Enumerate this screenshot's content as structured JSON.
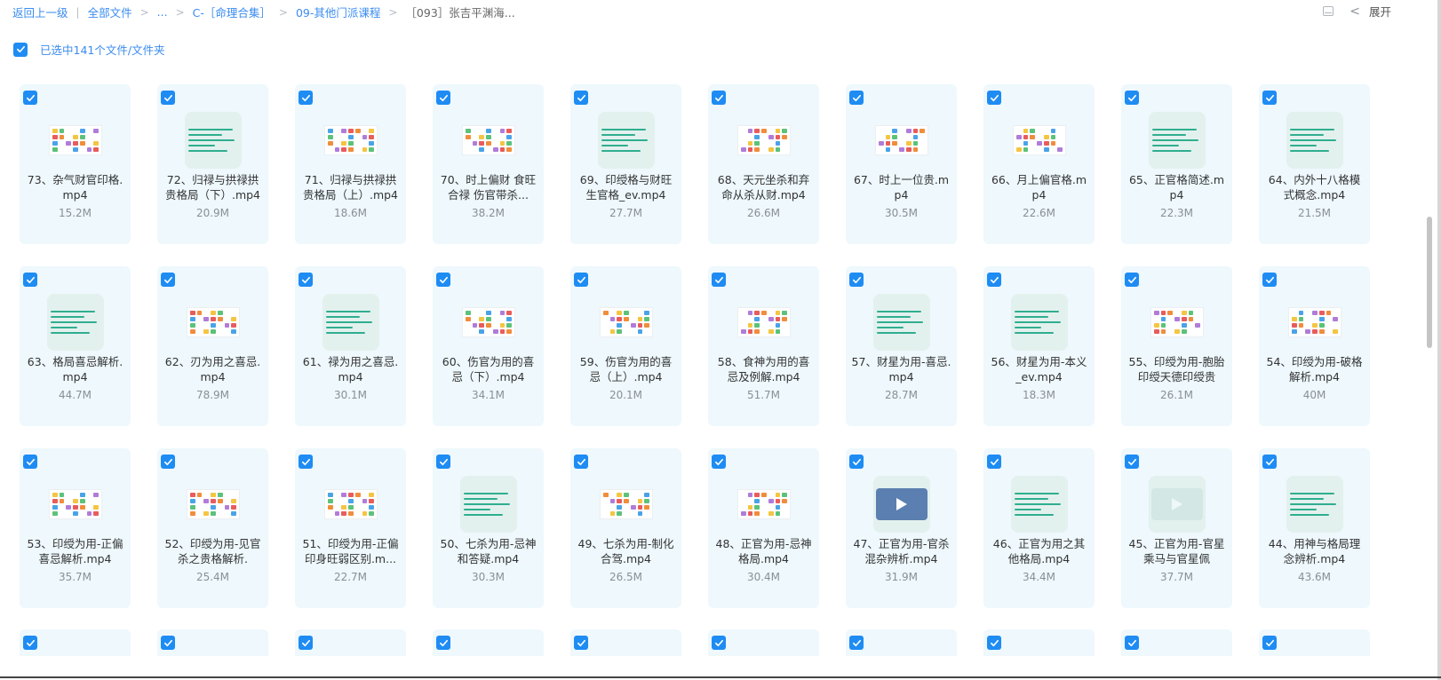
{
  "breadcrumb": {
    "back": "返回上一级",
    "all_files": "全部文件",
    "ellipsis": "...",
    "folder1": "C-［命理合集］",
    "folder2": "09-其他门派课程",
    "current": "［093］张吉平渊海..."
  },
  "toolbar": {
    "expand_label": "展开"
  },
  "selection": {
    "text": "已选中141个文件/文件夹"
  },
  "colors": {
    "accent": "#1e8cf3",
    "link": "#3b8cf0",
    "card_bg": "#eef8fd"
  },
  "files": [
    {
      "name": "73、杂气财官印格.mp4",
      "size": "15.2M",
      "thumb": "table"
    },
    {
      "name": "72、归禄与拱禄拱贵格局（下）.mp4",
      "size": "20.9M",
      "thumb": "text"
    },
    {
      "name": "71、归禄与拱禄拱贵格局（上）.mp4",
      "size": "18.6M",
      "thumb": "table"
    },
    {
      "name": "70、时上偏财 食旺合禄 伤官带杀...",
      "size": "38.2M",
      "thumb": "table"
    },
    {
      "name": "69、印绶格与财旺生官格_ev.mp4",
      "size": "27.7M",
      "thumb": "text"
    },
    {
      "name": "68、天元坐杀和弃命从杀从财.mp4",
      "size": "26.6M",
      "thumb": "table"
    },
    {
      "name": "67、时上一位贵.mp4",
      "size": "30.5M",
      "thumb": "table"
    },
    {
      "name": "66、月上偏官格.mp4",
      "size": "22.6M",
      "thumb": "table"
    },
    {
      "name": "65、正官格简述.mp4",
      "size": "22.3M",
      "thumb": "text"
    },
    {
      "name": "64、内外十八格模式概念.mp4",
      "size": "21.5M",
      "thumb": "text"
    },
    {
      "name": "63、格局喜忌解析.mp4",
      "size": "44.7M",
      "thumb": "text"
    },
    {
      "name": "62、刃为用之喜忌.mp4",
      "size": "78.9M",
      "thumb": "table"
    },
    {
      "name": "61、禄为用之喜忌.mp4",
      "size": "30.1M",
      "thumb": "text"
    },
    {
      "name": "60、伤官为用的喜忌（下）.mp4",
      "size": "34.1M",
      "thumb": "table"
    },
    {
      "name": "59、伤官为用的喜忌（上）.mp4",
      "size": "20.1M",
      "thumb": "table"
    },
    {
      "name": "58、食神为用的喜忌及例解.mp4",
      "size": "51.7M",
      "thumb": "table"
    },
    {
      "name": "57、财星为用-喜忌.mp4",
      "size": "28.7M",
      "thumb": "text"
    },
    {
      "name": "56、财星为用-本义_ev.mp4",
      "size": "18.3M",
      "thumb": "text"
    },
    {
      "name": "55、印绶为用-胞胎印绶天德印绶贵",
      "size": "26.1M",
      "thumb": "table"
    },
    {
      "name": "54、印绶为用-破格解析.mp4",
      "size": "40M",
      "thumb": "table"
    },
    {
      "name": "53、印绶为用-正偏喜忌解析.mp4",
      "size": "35.7M",
      "thumb": "table"
    },
    {
      "name": "52、印绶为用-见官杀之贵格解析.",
      "size": "25.4M",
      "thumb": "table"
    },
    {
      "name": "51、印绶为用-正偏印身旺弱区别.m...",
      "size": "22.7M",
      "thumb": "table"
    },
    {
      "name": "50、七杀为用-忌神和答疑.mp4",
      "size": "30.3M",
      "thumb": "text"
    },
    {
      "name": "49、七杀为用-制化合驾.mp4",
      "size": "26.5M",
      "thumb": "table"
    },
    {
      "name": "48、正官为用-忌神格局.mp4",
      "size": "30.4M",
      "thumb": "table"
    },
    {
      "name": "47、正官为用-官杀混杂辨析.mp4",
      "size": "31.9M",
      "thumb": "video"
    },
    {
      "name": "46、正官为用之其他格局.mp4",
      "size": "34.4M",
      "thumb": "text"
    },
    {
      "name": "45、正官为用-官星乘马与官星佩",
      "size": "37.7M",
      "thumb": "video-light"
    },
    {
      "name": "44、用神与格局理念辨析.mp4",
      "size": "43.6M",
      "thumb": "text"
    }
  ],
  "partial_row_count": 10
}
